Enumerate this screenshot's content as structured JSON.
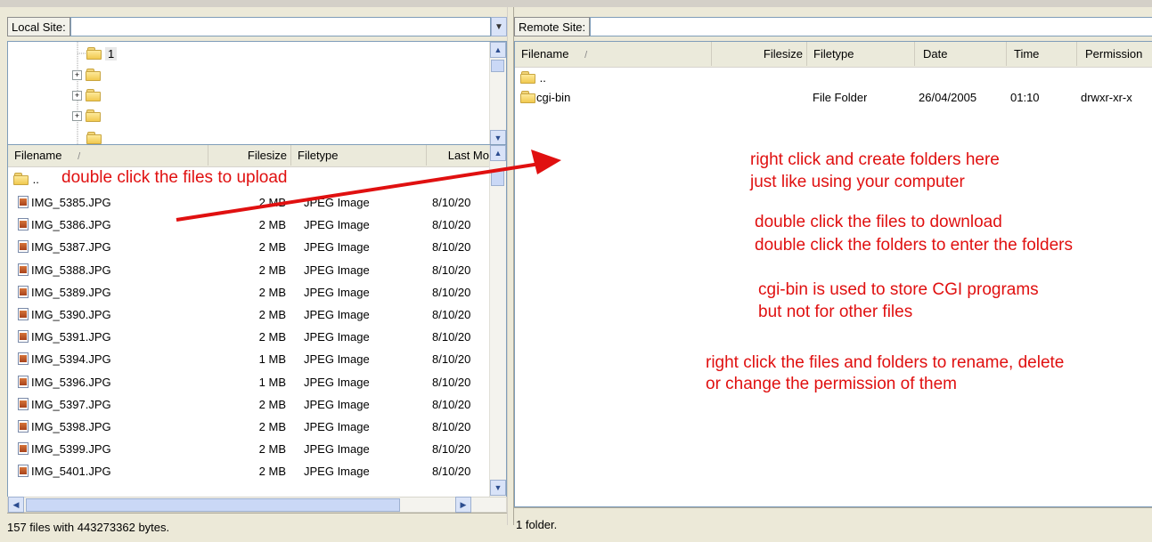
{
  "local": {
    "site_label": "Local Site:",
    "tree": {
      "selected_folder": "1"
    },
    "columns": {
      "filename": "Filename",
      "filesize": "Filesize",
      "filetype": "Filetype",
      "lastmod": "Last Mo"
    },
    "sort_glyph": "/",
    "parent_folder": "..",
    "files": [
      {
        "name": "IMG_5385.JPG",
        "size": "2 MB",
        "type": "JPEG Image",
        "date": "8/10/20"
      },
      {
        "name": "IMG_5386.JPG",
        "size": "2 MB",
        "type": "JPEG Image",
        "date": "8/10/20"
      },
      {
        "name": "IMG_5387.JPG",
        "size": "2 MB",
        "type": "JPEG Image",
        "date": "8/10/20"
      },
      {
        "name": "IMG_5388.JPG",
        "size": "2 MB",
        "type": "JPEG Image",
        "date": "8/10/20"
      },
      {
        "name": "IMG_5389.JPG",
        "size": "2 MB",
        "type": "JPEG Image",
        "date": "8/10/20"
      },
      {
        "name": "IMG_5390.JPG",
        "size": "2 MB",
        "type": "JPEG Image",
        "date": "8/10/20"
      },
      {
        "name": "IMG_5391.JPG",
        "size": "2 MB",
        "type": "JPEG Image",
        "date": "8/10/20"
      },
      {
        "name": "IMG_5394.JPG",
        "size": "1 MB",
        "type": "JPEG Image",
        "date": "8/10/20"
      },
      {
        "name": "IMG_5396.JPG",
        "size": "1 MB",
        "type": "JPEG Image",
        "date": "8/10/20"
      },
      {
        "name": "IMG_5397.JPG",
        "size": "2 MB",
        "type": "JPEG Image",
        "date": "8/10/20"
      },
      {
        "name": "IMG_5398.JPG",
        "size": "2 MB",
        "type": "JPEG Image",
        "date": "8/10/20"
      },
      {
        "name": "IMG_5399.JPG",
        "size": "2 MB",
        "type": "JPEG Image",
        "date": "8/10/20"
      },
      {
        "name": "IMG_5401.JPG",
        "size": "2 MB",
        "type": "JPEG Image",
        "date": "8/10/20"
      }
    ],
    "status": "157 files with 443273362 bytes."
  },
  "remote": {
    "site_label": "Remote Site:",
    "columns": {
      "filename": "Filename",
      "filesize": "Filesize",
      "filetype": "Filetype",
      "date": "Date",
      "time": "Time",
      "permission": "Permission"
    },
    "sort_glyph": "/",
    "parent_folder": "..",
    "entries": [
      {
        "name": "cgi-bin",
        "size": "",
        "type": "File Folder",
        "date": "26/04/2005",
        "time": "01:10",
        "perm": "drwxr-xr-x"
      }
    ],
    "status": "1 folder."
  },
  "annotations": {
    "upload": "double click the files to upload",
    "create_1": "right click and create folders here",
    "create_2": "just like using your computer",
    "download_1": "double click the files to download",
    "download_2": "double click the folders to enter the folders",
    "cgi_1": "cgi-bin is used to store CGI programs",
    "cgi_2": "but not for other files",
    "rename_1": "right click the files and folders to rename, delete",
    "rename_2": "or change the permission of them"
  },
  "colors": {
    "annotation": "#e01010",
    "window_bg": "#ece9d8"
  }
}
